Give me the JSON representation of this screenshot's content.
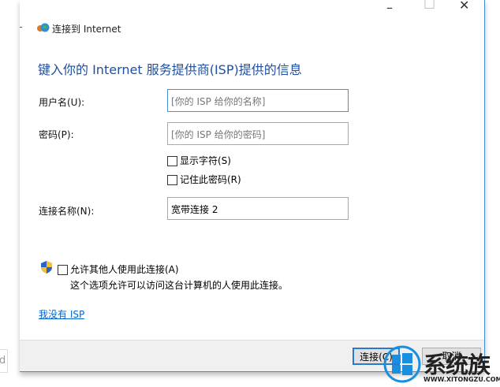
{
  "window": {
    "title": "连接到 Internet",
    "minimize": "–",
    "maximize": "□",
    "close": "✕"
  },
  "heading": "键入你的 Internet 服务提供商(ISP)提供的信息",
  "form": {
    "username_label": "用户名(U):",
    "username_placeholder": "[你的 ISP 给你的名称]",
    "password_label": "密码(P):",
    "password_placeholder": "[你的 ISP 给你的密码]",
    "show_chars": "显示字符(S)",
    "remember": "记住此密码(R)",
    "conn_name_label": "连接名称(N):",
    "conn_name_value": "宽带连接 2"
  },
  "allow_others": "允许其他人使用此连接(A)",
  "allow_desc": "这个选项允许可以访问这台计算机的人使用此连接。",
  "no_isp_link": "我没有 ISP",
  "footer": {
    "connect": "连接(C)",
    "cancel": "取消"
  },
  "watermark": {
    "brand": "系统族",
    "url": "WWW.XITONGZU.COM"
  },
  "bg_fragment": "d",
  "colors": {
    "heading": "#1e4fa3",
    "link": "#0066cc",
    "accent": "#3c8fd8"
  }
}
